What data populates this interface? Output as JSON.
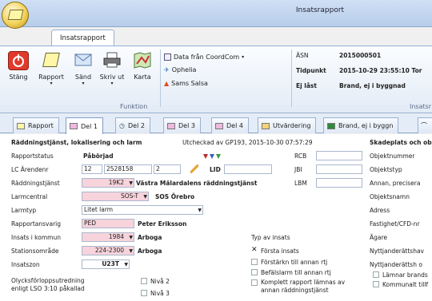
{
  "window": {
    "title": "Insatsrapport"
  },
  "ribbon": {
    "tab": "Insatsrapport",
    "buttons": {
      "close": "Stäng",
      "report": "Rapport",
      "send": "Sänd",
      "print": "Skriv ut",
      "map": "Karta"
    },
    "small": {
      "coordcom": "Data från CoordCom",
      "ophelia": "Ophelia",
      "salsa": "Sams Salsa"
    },
    "group_label": "Funktion",
    "group_label2": "Insatsr",
    "info": [
      {
        "label": "ÄSN",
        "value": "2015000501"
      },
      {
        "label": "Tidpunkt",
        "value": "2015-10-29 23:55:10 Tor"
      },
      {
        "label": "Ej låst",
        "value": "Brand, ej i byggnad"
      }
    ]
  },
  "tabs": [
    "Rapport",
    "Del 1",
    "Del 2",
    "Del 3",
    "Del 4",
    "Utvärdering",
    "Brand, ej i byggn"
  ],
  "colors": {
    "pink": "#f7d3dc",
    "active_tab": "#ffffff",
    "accent": "#8aa7cc"
  },
  "form": {
    "heading": "Räddningstjänst, lokalisering och larm",
    "checkout": "Utcheckad av GP193, 2015-10-30 07:57:29",
    "rapportstatus": {
      "label": "Rapportstatus",
      "value": "Påbörjad"
    },
    "lc_arende": {
      "label": "LC Ärendenr",
      "v1": "12",
      "v2": "2528158",
      "v3": "2",
      "lid": "LID"
    },
    "raddningstjanst": {
      "label": "Räddningstjänst",
      "code": "19K2",
      "name": "Västra Mälardalens räddningstjänst"
    },
    "larmcentral": {
      "label": "Larmcentral",
      "code": "SOS-T",
      "name": "SOS Örebro"
    },
    "larmtyp": {
      "label": "Larmtyp",
      "value": "Litet larm"
    },
    "rapportansvarig": {
      "label": "Rapportansvarig",
      "code": "PED",
      "name": "Peter Eriksson"
    },
    "insats_kommun": {
      "label": "Insats i kommun",
      "code": "1984",
      "name": "Arboga"
    },
    "stationsomrade": {
      "label": "Stationsområde",
      "code": "224-2300",
      "name": "Arboga"
    },
    "insatszon": {
      "label": "Insatszon",
      "code": "U23T"
    },
    "olycks": {
      "line1": "Olycksförloppsutredning",
      "line2": "enligt LSO 3:10 påkallad",
      "niva2": "Nivå 2",
      "niva3": "Nivå 3"
    },
    "mid": {
      "rcb": "RCB",
      "jbi": "JBI",
      "lbm": "LBM"
    },
    "typ_av_insats": {
      "title": "Typ av insats",
      "options": [
        "Första insats",
        "Förstärkn till annan rtj",
        "Befälslarm till annan rtj",
        "Komplett rapport lämnas av annan räddningstjänst"
      ]
    },
    "right": {
      "title": "Skadeplats och ob",
      "items": [
        "Objektnummer",
        "Objektstyp",
        "Annan, precisera",
        "Objektsnamn",
        "Adress",
        "Fastighet/CFD-nr",
        "Ägare",
        "Nyttjanderättshav",
        "Nyttjanderättsh o"
      ],
      "cb1": "Lämnar brands",
      "cb2": "Kommunalt tillf"
    }
  }
}
